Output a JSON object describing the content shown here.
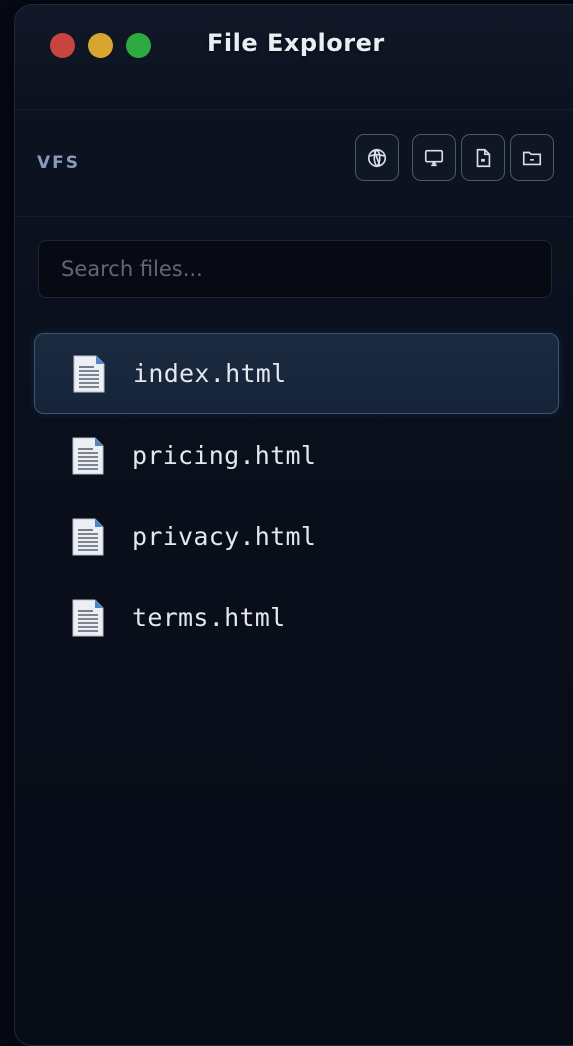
{
  "window": {
    "title": "File Explorer",
    "controls": {
      "close_color": "#c8453f",
      "minimize_color": "#d6a630",
      "maximize_color": "#2faa43"
    }
  },
  "toolbar": {
    "label": "VFS",
    "buttons": [
      {
        "icon": "globe-icon"
      },
      {
        "icon": "monitor-icon"
      },
      {
        "icon": "new-file-icon"
      },
      {
        "icon": "new-folder-icon"
      }
    ]
  },
  "search": {
    "placeholder": "Search files...",
    "value": ""
  },
  "files": [
    {
      "name": "index.html",
      "icon": "document-icon",
      "selected": true
    },
    {
      "name": "pricing.html",
      "icon": "document-icon",
      "selected": false
    },
    {
      "name": "privacy.html",
      "icon": "document-icon",
      "selected": false
    },
    {
      "name": "terms.html",
      "icon": "document-icon",
      "selected": false
    }
  ],
  "colors": {
    "background": "#060a14",
    "accent_selected": "#1b2a3f",
    "text": "#e3e7ee",
    "muted": "#8a9bb8"
  }
}
